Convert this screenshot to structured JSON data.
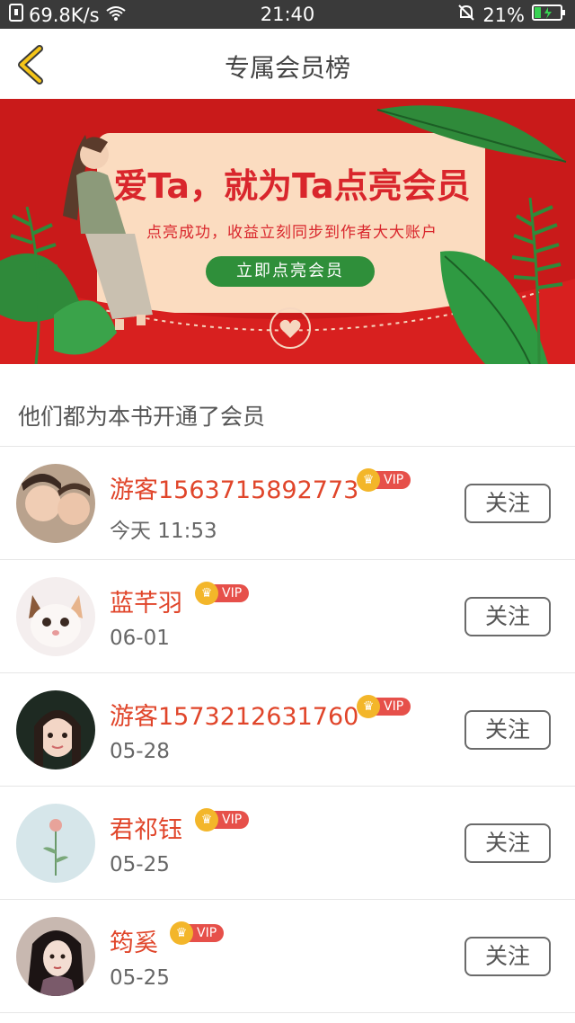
{
  "status_bar": {
    "speed": "69.8K/s",
    "time": "21:40",
    "battery": "21%"
  },
  "header": {
    "title": "专属会员榜"
  },
  "banner": {
    "title": "爱Ta，就为Ta点亮会员",
    "subtitle": "点亮成功，收益立刻同步到作者大大账户",
    "button_label": "立即点亮会员"
  },
  "section": {
    "title": "他们都为本书开通了会员"
  },
  "vip_label": "VIP",
  "follow_label": "关注",
  "members": [
    {
      "name": "游客1563715892773",
      "time": "今天 11:53"
    },
    {
      "name": "蓝芊羽",
      "time": "06-01"
    },
    {
      "name": "游客1573212631760",
      "time": "05-28"
    },
    {
      "name": "君祁钰",
      "time": "05-25"
    },
    {
      "name": "筠奚",
      "time": "05-25"
    }
  ],
  "colors": {
    "accent_red": "#e0452a",
    "banner_red": "#cc1d1d",
    "button_green": "#2f8f3a",
    "vip_gold": "#f3b62a"
  },
  "icons": [
    "sim-icon",
    "wifi-icon",
    "mute-bell-icon",
    "battery-icon",
    "back-chevron-icon",
    "crown-icon"
  ]
}
